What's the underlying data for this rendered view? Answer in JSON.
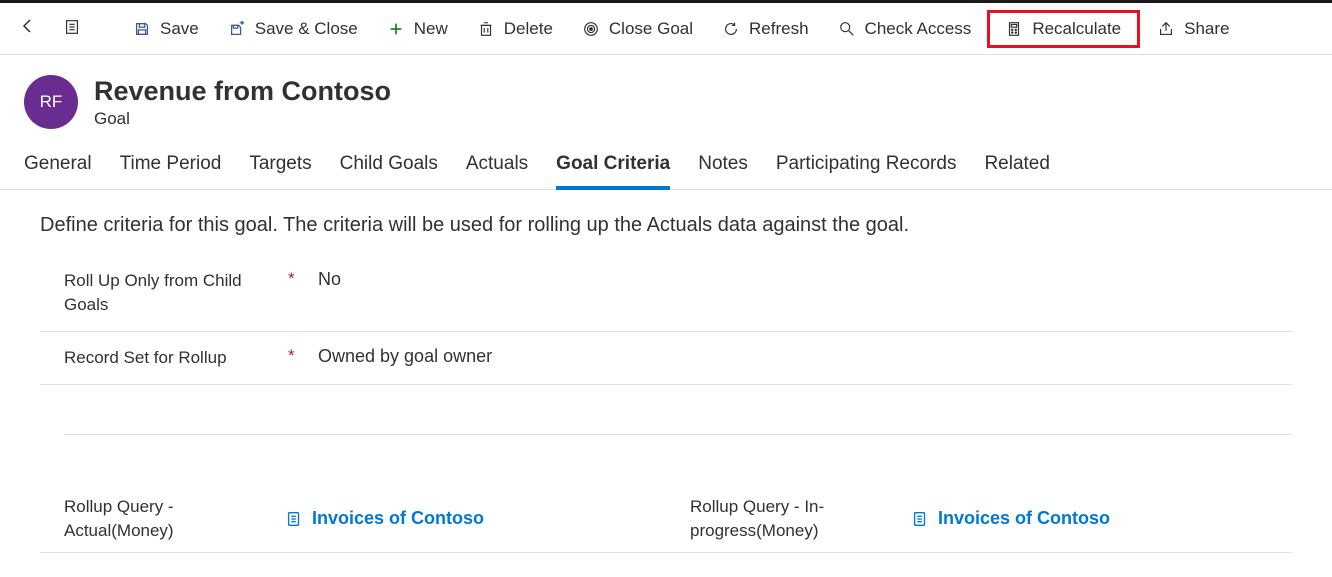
{
  "toolbar": {
    "save": "Save",
    "save_close": "Save & Close",
    "new": "New",
    "delete": "Delete",
    "close_goal": "Close Goal",
    "refresh": "Refresh",
    "check_access": "Check Access",
    "recalculate": "Recalculate",
    "share": "Share"
  },
  "header": {
    "avatar_initials": "RF",
    "title": "Revenue from Contoso",
    "entity": "Goal"
  },
  "tabs": {
    "general": "General",
    "time_period": "Time Period",
    "targets": "Targets",
    "child_goals": "Child Goals",
    "actuals": "Actuals",
    "goal_criteria": "Goal Criteria",
    "notes": "Notes",
    "participating_records": "Participating Records",
    "related": "Related"
  },
  "content": {
    "description": "Define criteria for this goal. The criteria will be used for rolling up the Actuals data against the goal.",
    "fields": {
      "rollup_only_label": "Roll Up Only from Child Goals",
      "rollup_only_value": "No",
      "record_set_label": "Record Set for Rollup",
      "record_set_value": "Owned by goal owner",
      "rollup_query_actual_label": "Rollup Query - Actual(Money)",
      "rollup_query_actual_value": "Invoices of Contoso",
      "rollup_query_inprogress_label": "Rollup Query - In-progress(Money)",
      "rollup_query_inprogress_value": "Invoices of Contoso"
    }
  }
}
